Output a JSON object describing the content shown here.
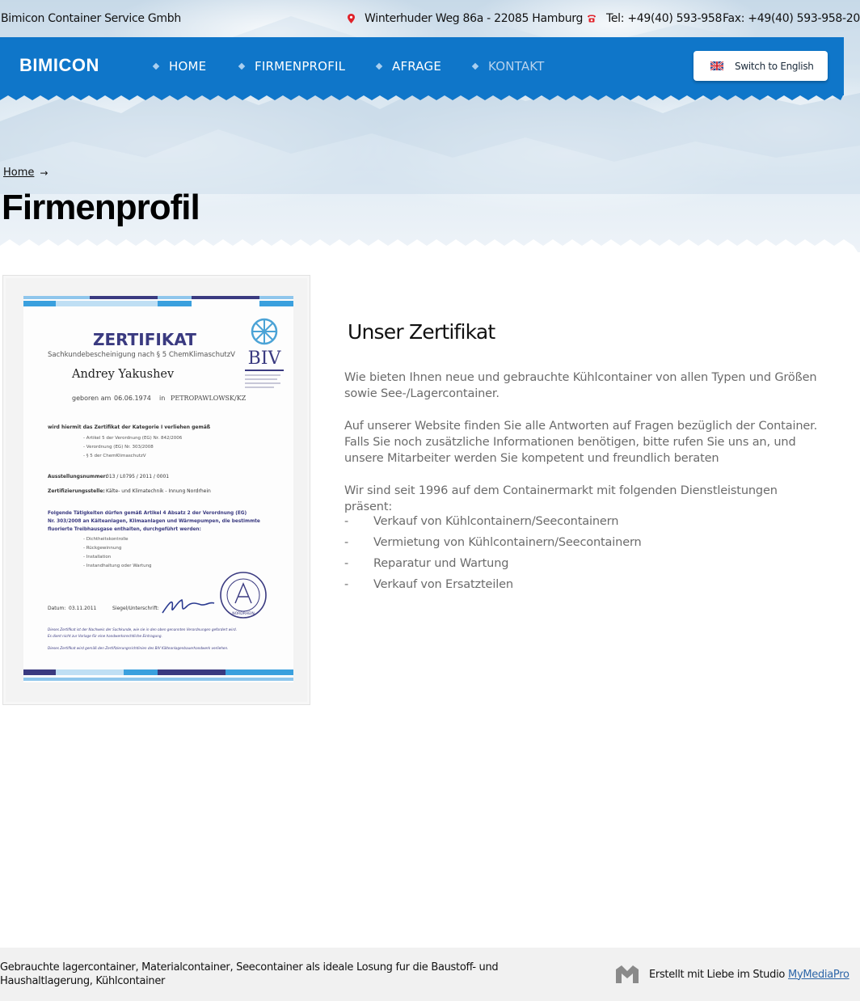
{
  "topbar": {
    "company": "Bimicon Container Service Gmbh",
    "address": "Winterhuder Weg 86a - 22085 Hamburg",
    "phone": "Tel: +49(40) 593-958",
    "fax": "Fax: +49(40) 593-958-20"
  },
  "nav": {
    "logo": "BIMICON",
    "items": [
      {
        "label": "HOME"
      },
      {
        "label": "FIRMENPROFIL"
      },
      {
        "label": "AFRAGE"
      },
      {
        "label": "KONTAKT"
      }
    ],
    "lang_button": "Switch to English"
  },
  "breadcrumb": {
    "home": "Home"
  },
  "page_title": "Firmenprofil",
  "certificate": {
    "heading": "ZERTIFIKAT",
    "subheading": "Sachkundebescheinigung nach § 5 ChemKlimaschutzV",
    "name": "Andrey Yakushev",
    "born_label": "geboren am",
    "born_date": "06.06.1974",
    "in_label": "in",
    "born_place": "PETROPAWLOWSK/KZ",
    "logo_text": "BIV",
    "category_line": "wird hiermit das Zertifikat der Kategorie I verliehen gemäß",
    "regs": [
      "- Artikel 5 der Verordnung (EG) Nr. 842/2006",
      "- Verordnung (EG) Nr. 303/2008",
      "- § 5 der ChemKlimaschutzV"
    ],
    "issue_label": "Ausstellungsnummer:",
    "issue_number": "013 / L0795 / 2011 / 0001",
    "body_label": "Zertifizierungsstelle:",
    "body_value": "Kälte- und Klimatechnik - Innung Nordrhein",
    "activities_intro": [
      "Folgende Tätigkeiten dürfen gemäß Artikel 4 Absatz 2 der Verordnung (EG)",
      "Nr. 303/2008 an Kälteanlagen, Klimaanlagen und Wärmepumpen, die bestimmte",
      "fluorierte Treibhausgase enthalten, durchgeführt werden:"
    ],
    "activities": [
      "- Dichtheitskontrolle",
      "- Rückgewinnung",
      "- Installation",
      "- Instandhaltung oder Wartung"
    ],
    "date_label": "Datum:",
    "date_value": "03.11.2011",
    "seal_label": "Siegel/Unterschrift:",
    "seal_text": "NORDRHEIN",
    "footnotes": [
      "Dieses Zertifikat ist der Nachweis der Sachkunde, wie sie in den oben genannten Verordnungen gefordert wird.",
      "Es dient nicht zur Vorlage für eine handwerksrechtliche Eintragung.",
      "Dieses Zertifikat wird gemäß den Zertifizierungsrichtlinien des BIV Kälteanlagenbauerhandwerk verliehen."
    ]
  },
  "content": {
    "title": "Unser Zertifikat",
    "paragraphs": [
      "Wie bieten Ihnen neue und gebrauchte Kühlcontainer von allen Typen und Größen sowie See-/Lagercontainer.",
      "Auf unserer Website finden Sie alle Antworten auf Fragen bezüglich der Container. Falls Sie noch zusätzliche Informationen benötigen, bitte rufen Sie uns an, und unsere Mitarbeiter werden Sie kompetent und freundlich beraten",
      "Wir sind seit 1996 auf dem Containermarkt mit folgenden Dienstleistungen präsent:"
    ],
    "dash": "-",
    "services": [
      "Verkauf von Kühlcontainern/Seecontainern",
      "Vermietung von Kühlcontainern/Seecontainern",
      "Reparatur und Wartung",
      "Verkauf von Ersatzteilen"
    ]
  },
  "footer": {
    "text": "Gebrauchte lagercontainer, Materialcontainer, Seecontainer als ideale Losung fur die Baustoff- und Haushaltlagerung, Kühlcontainer",
    "credit": "Erstellt mit Liebe im Studio",
    "credit_link": "MyMediaPro"
  },
  "colors": {
    "nav_bg": "#0f76c9",
    "accent_red": "#e0222a",
    "link": "#2d66a8",
    "body_text": "#6b6b6b"
  },
  "icons": [
    "map-pin-icon",
    "phone-icon",
    "uk-flag-icon",
    "arrow-right-icon",
    "mymediapro-logo-icon"
  ]
}
